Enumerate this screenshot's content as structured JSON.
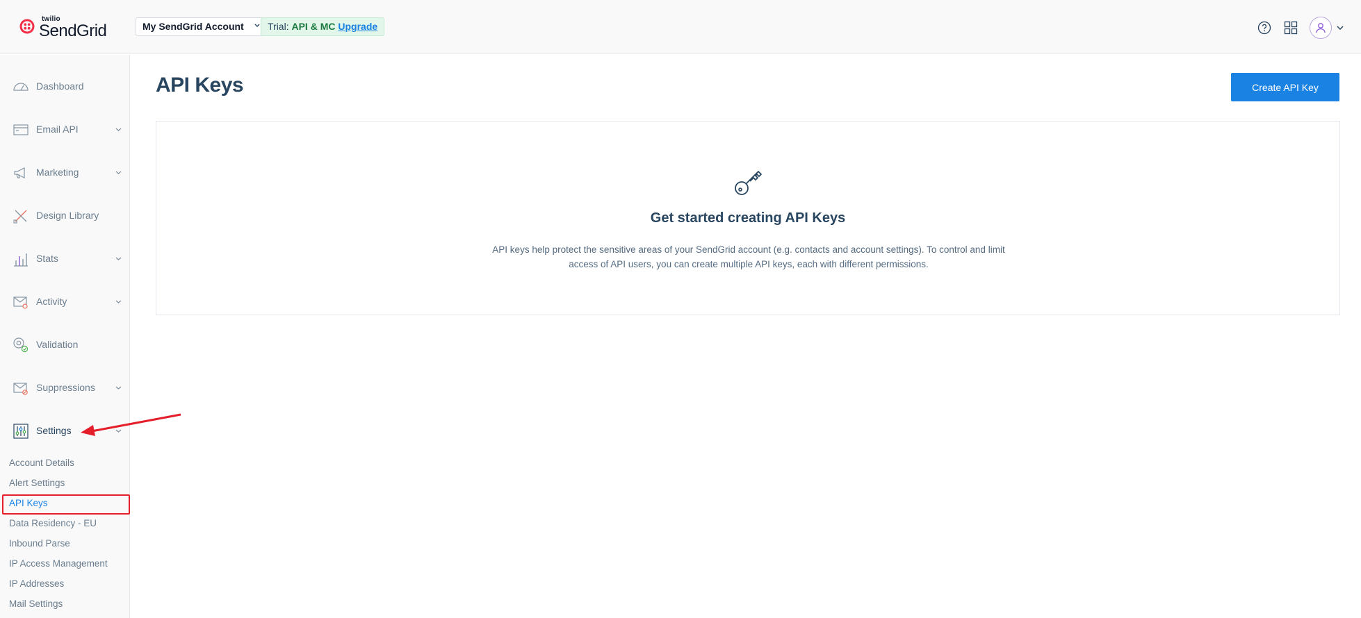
{
  "header": {
    "logo_small": "twilio",
    "logo_main": "SendGrid",
    "account_selector": "My SendGrid Account",
    "trial_prefix": "Trial:",
    "trial_plan": "API & MC",
    "upgrade_link": "Upgrade",
    "icons": [
      "help-icon",
      "apps-grid-icon",
      "user-avatar-icon",
      "chevron-down-icon"
    ]
  },
  "sidebar": {
    "items": [
      {
        "label": "Dashboard",
        "icon": "dashboard-gauge-icon",
        "expandable": false
      },
      {
        "label": "Email API",
        "icon": "email-api-icon",
        "expandable": true
      },
      {
        "label": "Marketing",
        "icon": "megaphone-icon",
        "expandable": true
      },
      {
        "label": "Design Library",
        "icon": "design-tools-icon",
        "expandable": false
      },
      {
        "label": "Stats",
        "icon": "bar-chart-icon",
        "expandable": true
      },
      {
        "label": "Activity",
        "icon": "envelope-search-icon",
        "expandable": true
      },
      {
        "label": "Validation",
        "icon": "at-check-icon",
        "expandable": false
      },
      {
        "label": "Suppressions",
        "icon": "envelope-block-icon",
        "expandable": true
      },
      {
        "label": "Settings",
        "icon": "settings-sliders-icon",
        "expandable": true
      }
    ],
    "settings_subitems": [
      {
        "label": "Account Details",
        "selected": false
      },
      {
        "label": "Alert Settings",
        "selected": false
      },
      {
        "label": "API Keys",
        "selected": true
      },
      {
        "label": "Data Residency - EU",
        "selected": false
      },
      {
        "label": "Inbound Parse",
        "selected": false
      },
      {
        "label": "IP Access Management",
        "selected": false
      },
      {
        "label": "IP Addresses",
        "selected": false
      },
      {
        "label": "Mail Settings",
        "selected": false
      }
    ]
  },
  "main": {
    "title": "API Keys",
    "create_button": "Create API Key",
    "empty_state": {
      "icon": "key-icon",
      "title": "Get started creating API Keys",
      "description": "API keys help protect the sensitive areas of your SendGrid account (e.g. contacts and account settings). To control and limit access of API users, you can create multiple API keys, each with different permissions."
    }
  },
  "colors": {
    "accent": "#1a82e2",
    "title": "#294661",
    "annotation": "#e41e2b",
    "trial_bg": "#e3f6ea",
    "trial_plan": "#1c7a40"
  }
}
